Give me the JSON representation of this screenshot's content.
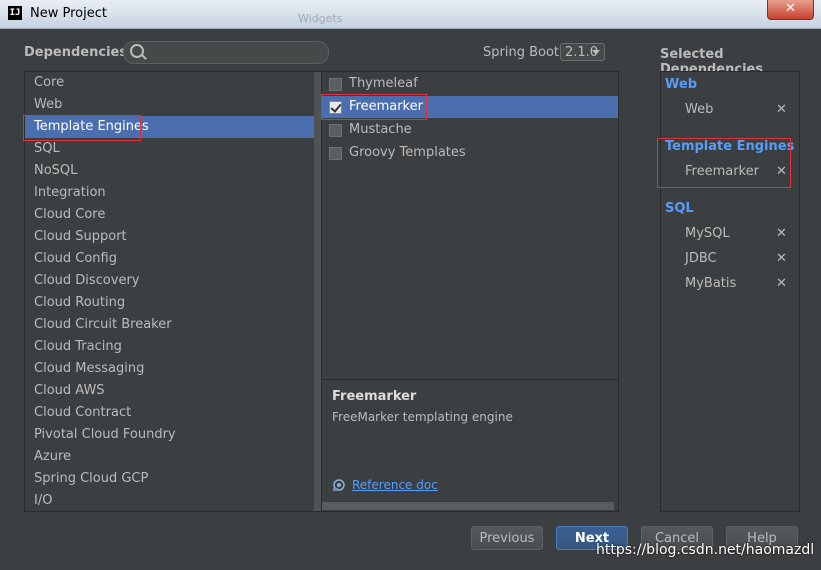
{
  "window": {
    "title": "New Project",
    "background_tab": "Widgets",
    "close_glyph": "✕",
    "app_icon_text": "IJ"
  },
  "header": {
    "dependencies_label": "Dependencies",
    "search_placeholder": "",
    "spring_boot_label": "Spring Boot",
    "spring_boot_version": "2.1.0"
  },
  "categories": [
    {
      "label": "Core",
      "selected": false
    },
    {
      "label": "Web",
      "selected": false
    },
    {
      "label": "Template Engines",
      "selected": true
    },
    {
      "label": "SQL",
      "selected": false
    },
    {
      "label": "NoSQL",
      "selected": false
    },
    {
      "label": "Integration",
      "selected": false
    },
    {
      "label": "Cloud Core",
      "selected": false
    },
    {
      "label": "Cloud Support",
      "selected": false
    },
    {
      "label": "Cloud Config",
      "selected": false
    },
    {
      "label": "Cloud Discovery",
      "selected": false
    },
    {
      "label": "Cloud Routing",
      "selected": false
    },
    {
      "label": "Cloud Circuit Breaker",
      "selected": false
    },
    {
      "label": "Cloud Tracing",
      "selected": false
    },
    {
      "label": "Cloud Messaging",
      "selected": false
    },
    {
      "label": "Cloud AWS",
      "selected": false
    },
    {
      "label": "Cloud Contract",
      "selected": false
    },
    {
      "label": "Pivotal Cloud Foundry",
      "selected": false
    },
    {
      "label": "Azure",
      "selected": false
    },
    {
      "label": "Spring Cloud GCP",
      "selected": false
    },
    {
      "label": "I/O",
      "selected": false
    }
  ],
  "dependencies": [
    {
      "label": "Thymeleaf",
      "checked": false,
      "selected": false
    },
    {
      "label": "Freemarker",
      "checked": true,
      "selected": true
    },
    {
      "label": "Mustache",
      "checked": false,
      "selected": false
    },
    {
      "label": "Groovy Templates",
      "checked": false,
      "selected": false
    }
  ],
  "description": {
    "title": "Freemarker",
    "text": "FreeMarker templating engine",
    "reference_link": "Reference doc"
  },
  "selected_dependencies": {
    "title": "Selected Dependencies",
    "remove_glyph": "✕",
    "groups": [
      {
        "name": "Web",
        "items": [
          "Web"
        ]
      },
      {
        "name": "Template Engines",
        "items": [
          "Freemarker"
        ]
      },
      {
        "name": "SQL",
        "items": [
          "MySQL",
          "JDBC",
          "MyBatis"
        ]
      }
    ]
  },
  "buttons": {
    "previous": "Previous",
    "next": "Next",
    "cancel": "Cancel",
    "help": "Help"
  },
  "watermark": "https://blog.csdn.net/haomazdl",
  "colors": {
    "background": "#3c3f41",
    "selection": "#4b6eaf",
    "link": "#589df6",
    "highlight_box": "#e0313a"
  }
}
